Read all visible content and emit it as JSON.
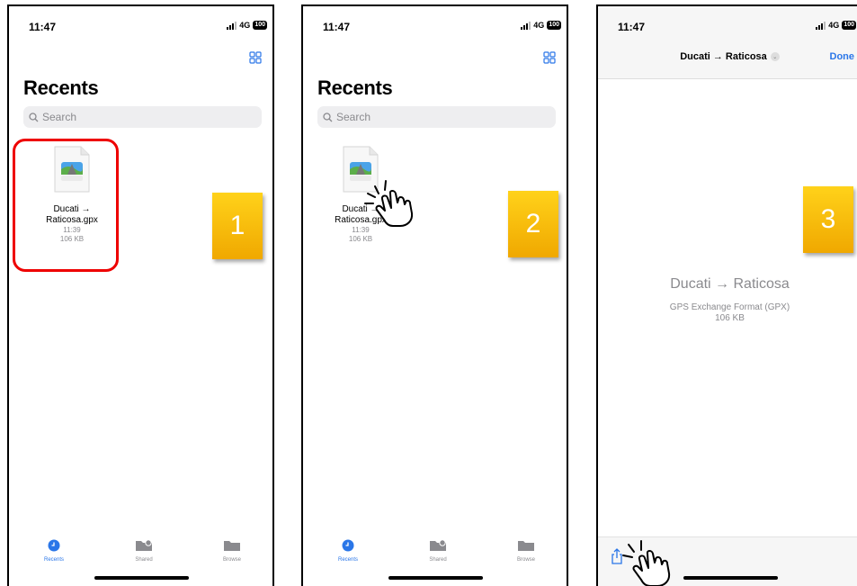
{
  "status": {
    "time": "11:47",
    "network": "4G",
    "battery": "100"
  },
  "recents": {
    "title": "Recents",
    "search_placeholder": "Search",
    "file": {
      "name_line1": "Ducati →",
      "name_line2": "Raticosa.gpx",
      "time": "11:39",
      "size": "106 KB"
    }
  },
  "tabs": [
    {
      "label": "Recents"
    },
    {
      "label": "Shared"
    },
    {
      "label": "Browse"
    }
  ],
  "steps": [
    "1",
    "2",
    "3"
  ],
  "preview": {
    "nav_title": "Ducati → Raticosa",
    "done_label": "Done",
    "file_name": "Ducati → Raticosa",
    "format": "GPS Exchange Format (GPX)",
    "size": "106 KB"
  },
  "colors": {
    "accent": "#2a76e8",
    "highlight": "#e00000",
    "badge": "#f5b800"
  }
}
